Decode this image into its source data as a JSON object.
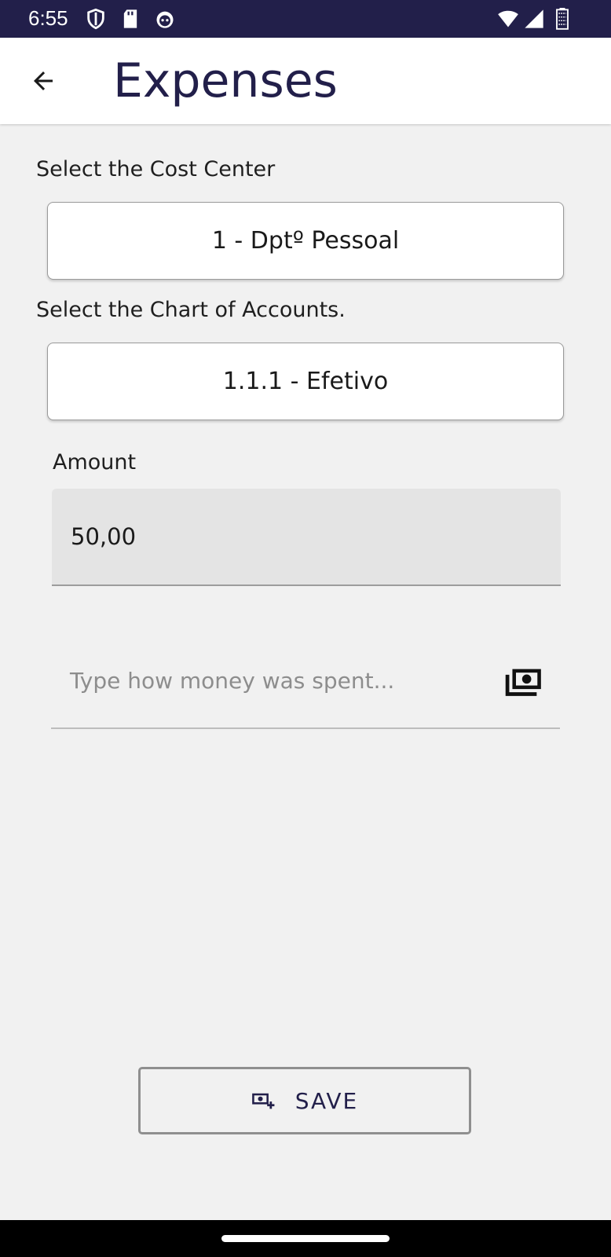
{
  "status_bar": {
    "time": "6:55",
    "background": "#221f4a",
    "left_icons": [
      "shield-icon",
      "sd-card-icon",
      "cat-face-icon"
    ],
    "right_icons": [
      "wifi-icon",
      "signal-icon",
      "battery-icon"
    ]
  },
  "app_bar": {
    "title": "Expenses",
    "back_icon": "arrow-back-icon",
    "title_color": "#221f4a"
  },
  "form": {
    "cost_center": {
      "label": "Select the Cost Center",
      "selected": "1 - Dptº Pessoal"
    },
    "chart_of_accounts": {
      "label": "Select the Chart of Accounts.",
      "selected": "1.1.1 - Efetivo"
    },
    "amount": {
      "label": "Amount",
      "value": "50,00"
    },
    "description": {
      "placeholder": "Type how money was spent...",
      "icon": "money-icon"
    }
  },
  "actions": {
    "save_label": "SAVE",
    "save_icon": "add-money-icon"
  }
}
